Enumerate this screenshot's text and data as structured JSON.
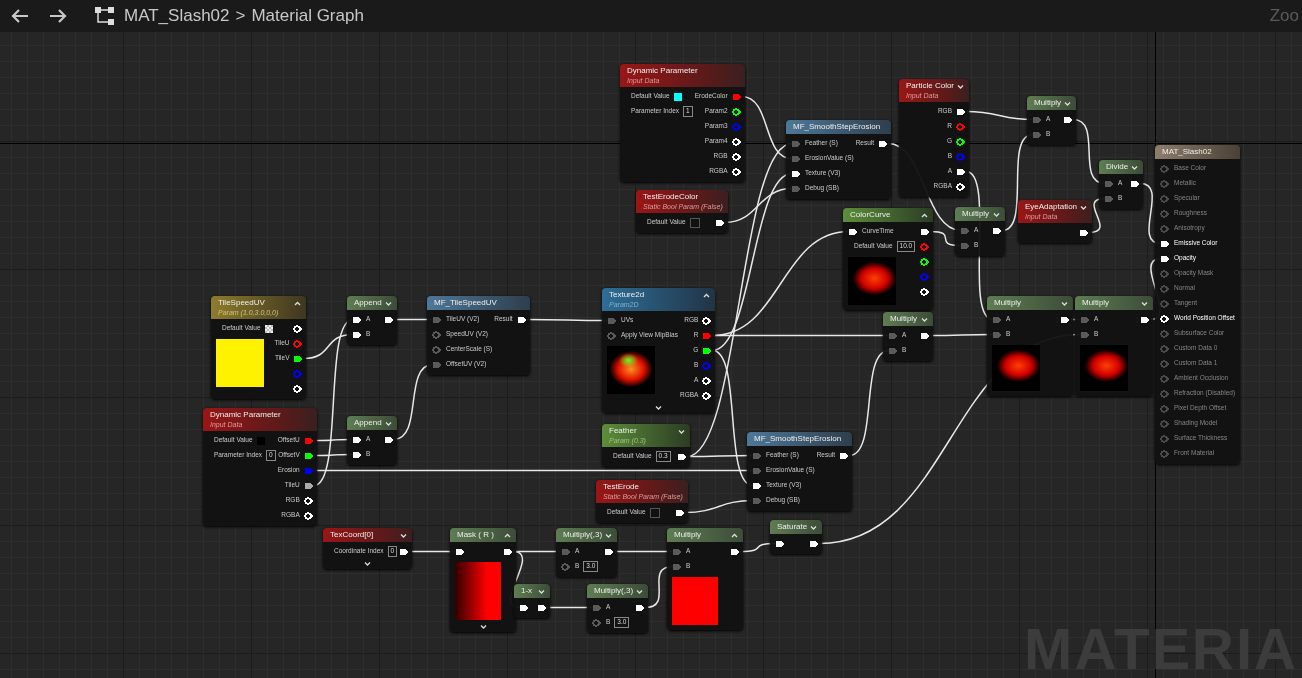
{
  "toolbar": {
    "breadcrumb": [
      {
        "label": "MAT_Slash02"
      },
      {
        "label": "Material Graph"
      }
    ],
    "separator": ">",
    "zoom_label": "Zoo"
  },
  "graph": {
    "watermark": "MATERIA",
    "nodes": [
      {
        "title": "Dynamic Parameter",
        "subtitle": "Input Data",
        "kind": "param",
        "props": [
          {
            "label": "Default Value",
            "kind": "swatch",
            "color": "#00ffff"
          },
          {
            "label": "Parameter Index",
            "kind": "number",
            "value": "1"
          }
        ],
        "outputs": [
          {
            "label": "ErodeColor",
            "color": "#ff0000",
            "connected": true
          },
          {
            "label": "Param2",
            "color": "#00ff00",
            "connected": false
          },
          {
            "label": "Param3",
            "color": "#0000ff",
            "connected": false
          },
          {
            "label": "Param4",
            "color": "#ffffff",
            "connected": false
          },
          {
            "label": "RGB",
            "color": "#ffffff",
            "connected": false
          },
          {
            "label": "RGBA",
            "color": "#ffffff",
            "connected": false
          }
        ]
      },
      {
        "title": "MF_SmoothStepErosion",
        "kind": "function",
        "inputs": [
          {
            "label": "Feather (S)",
            "color": "#5a5a5a",
            "connected": true
          },
          {
            "label": "ErosionValue (S)",
            "color": "#5a5a5a",
            "connected": true
          },
          {
            "label": "Texture (V3)",
            "color": "#ffffff",
            "connected": true
          },
          {
            "label": "Debug (SB)",
            "color": "#5a5a5a",
            "connected": true
          }
        ],
        "outputs": [
          {
            "label": "Result",
            "color": "#ffffff",
            "connected": true
          }
        ]
      },
      {
        "title": "TestErodeColor",
        "subtitle": "Static Bool Param (False)",
        "kind": "param",
        "props": [
          {
            "label": "Default Value",
            "kind": "checkbox",
            "checked": false
          }
        ],
        "outputs": [
          {
            "color": "#ffffff",
            "connected": true
          }
        ]
      },
      {
        "title": "Particle Color",
        "subtitle": "Input Data",
        "kind": "param",
        "expanded": false,
        "outputs": [
          {
            "label": "RGB",
            "color": "#ffffff",
            "connected": true
          },
          {
            "label": "R",
            "color": "#ff0000",
            "connected": false
          },
          {
            "label": "G",
            "color": "#00ff00",
            "connected": false
          },
          {
            "label": "B",
            "color": "#0000ff",
            "connected": false
          },
          {
            "label": "A",
            "color": "#ffffff",
            "connected": true
          },
          {
            "label": "RGBA",
            "color": "#ffffff",
            "connected": false
          }
        ]
      },
      {
        "title": "Multiply",
        "kind": "math",
        "expanded": false,
        "inputs": [
          {
            "label": "A",
            "color": "#5a5a5a",
            "connected": true
          },
          {
            "label": "B",
            "color": "#5a5a5a",
            "connected": true
          }
        ],
        "outputs": [
          {
            "color": "#ffffff",
            "connected": true
          }
        ]
      },
      {
        "title": "Divide",
        "kind": "math",
        "expanded": false,
        "inputs": [
          {
            "label": "A",
            "color": "#5a5a5a",
            "connected": true
          },
          {
            "label": "B",
            "color": "#5a5a5a",
            "connected": true
          }
        ],
        "outputs": [
          {
            "color": "#ffffff",
            "connected": true
          }
        ]
      },
      {
        "title": "EyeAdaptation",
        "subtitle": "Input Data",
        "kind": "param",
        "expanded": false,
        "outputs": [
          {
            "color": "#ffffff",
            "connected": true
          }
        ]
      },
      {
        "title": "ColorCurve",
        "kind": "scalar",
        "expanded": true,
        "inputs": [
          {
            "label": "CurveTime",
            "color": "#ffffff",
            "connected": true
          }
        ],
        "props": [
          {
            "label": "Default Value",
            "kind": "number",
            "value": "10.0"
          }
        ],
        "preview": {
          "kind": "flame"
        },
        "outputs": [
          {
            "color": "#ffffff",
            "connected": true
          },
          {
            "color": "#ff0000",
            "connected": false
          },
          {
            "color": "#00ff00",
            "connected": false
          },
          {
            "color": "#0000ff",
            "connected": false
          },
          {
            "color": "#ffffff",
            "connected": false
          }
        ]
      },
      {
        "title": "Multiply",
        "kind": "math",
        "expanded": false,
        "inputs": [
          {
            "label": "A",
            "color": "#5a5a5a",
            "connected": true
          },
          {
            "label": "B",
            "color": "#5a5a5a",
            "connected": true
          }
        ],
        "outputs": [
          {
            "color": "#ffffff",
            "connected": true
          }
        ]
      },
      {
        "title": "MAT_Slash02",
        "kind": "result",
        "inputs": [
          {
            "label": "Base Color",
            "enabled": false,
            "connected": false
          },
          {
            "label": "Metallic",
            "enabled": false,
            "connected": false
          },
          {
            "label": "Specular",
            "enabled": false,
            "connected": false
          },
          {
            "label": "Roughness",
            "enabled": false,
            "connected": false
          },
          {
            "label": "Anisotropy",
            "enabled": false,
            "connected": false
          },
          {
            "label": "Emissive Color",
            "enabled": true,
            "connected": true
          },
          {
            "label": "Opacity",
            "enabled": true,
            "connected": true
          },
          {
            "label": "Opacity Mask",
            "enabled": false,
            "connected": false
          },
          {
            "label": "Normal",
            "enabled": false,
            "connected": false
          },
          {
            "label": "Tangent",
            "enabled": false,
            "connected": false
          },
          {
            "label": "World Position Offset",
            "enabled": true,
            "connected": false
          },
          {
            "label": "Subsurface Color",
            "enabled": false,
            "connected": false
          },
          {
            "label": "Custom Data 0",
            "enabled": false,
            "connected": false
          },
          {
            "label": "Custom Data 1",
            "enabled": false,
            "connected": false
          },
          {
            "label": "Ambient Occlusion",
            "enabled": false,
            "connected": false
          },
          {
            "label": "Refraction (Disabled)",
            "enabled": false,
            "connected": false
          },
          {
            "label": "Pixel Depth Offset",
            "enabled": false,
            "connected": false
          },
          {
            "label": "Shading Model",
            "enabled": false,
            "connected": false
          },
          {
            "label": "Surface Thickness",
            "enabled": false,
            "connected": false
          },
          {
            "label": "Front Material",
            "enabled": false,
            "connected": false
          }
        ]
      },
      {
        "title": "TileSpeedUV",
        "subtitle": "Param (1.0,3.0,0,0)",
        "kind": "vector",
        "expanded": true,
        "props": [
          {
            "label": "Default Value",
            "kind": "checker"
          }
        ],
        "preview": {
          "kind": "solid",
          "color": "#fff200"
        },
        "outputs": [
          {
            "color": "#ffffff",
            "connected": false
          },
          {
            "label": "TileU",
            "color": "#ff0000",
            "connected": false
          },
          {
            "label": "TileV",
            "color": "#00ff00",
            "connected": true
          },
          {
            "color": "#0000ff",
            "connected": false
          },
          {
            "color": "#ffffff",
            "connected": false
          }
        ]
      },
      {
        "title": "Append",
        "kind": "math",
        "expanded": false,
        "inputs": [
          {
            "label": "A",
            "color": "#ffffff",
            "connected": true
          },
          {
            "label": "B",
            "color": "#ffffff",
            "connected": true
          }
        ],
        "outputs": [
          {
            "color": "#ffffff",
            "connected": true
          }
        ]
      },
      {
        "title": "MF_TileSpeedUV",
        "kind": "function",
        "inputs": [
          {
            "label": "TileUV (V2)",
            "color": "#5a5a5a",
            "connected": true
          },
          {
            "label": "SpeedUV (V2)",
            "color": "#5a5a5a",
            "connected": false
          },
          {
            "label": "CenterScale (S)",
            "color": "#5a5a5a",
            "connected": false
          },
          {
            "label": "OffsetUV (V2)",
            "color": "#5a5a5a",
            "connected": true
          }
        ],
        "outputs": [
          {
            "label": "Result",
            "color": "#ffffff",
            "connected": true
          }
        ]
      },
      {
        "title": "Texture2d",
        "subtitle": "Param2D",
        "kind": "texture",
        "expanded": true,
        "show_more": true,
        "inputs": [
          {
            "label": "UVs",
            "color": "#5a5a5a",
            "connected": true
          },
          {
            "label": "Apply View MipBias",
            "color": "#5a5a5a",
            "connected": false
          }
        ],
        "preview": {
          "kind": "flame_green"
        },
        "outputs": [
          {
            "label": "RGB",
            "color": "#ffffff",
            "connected": false
          },
          {
            "label": "R",
            "color": "#ff0000",
            "connected": true
          },
          {
            "label": "G",
            "color": "#00ff00",
            "connected": true
          },
          {
            "label": "B",
            "color": "#0000ff",
            "connected": false
          },
          {
            "label": "A",
            "color": "#ffffff",
            "connected": false
          },
          {
            "label": "RGBA",
            "color": "#ffffff",
            "connected": false
          }
        ]
      },
      {
        "title": "Dynamic Parameter",
        "subtitle": "Input Data",
        "kind": "param",
        "props": [
          {
            "label": "Default Value",
            "kind": "swatch",
            "color": "#000000"
          },
          {
            "label": "Parameter Index",
            "kind": "number",
            "value": "0"
          }
        ],
        "outputs": [
          {
            "label": "OffsetU",
            "color": "#ff0000",
            "connected": true
          },
          {
            "label": "OffsetV",
            "color": "#00ff00",
            "connected": true
          },
          {
            "label": "Erosion",
            "color": "#0000ff",
            "connected": true
          },
          {
            "label": "TileU",
            "color": "#aaaaaa",
            "connected": true
          },
          {
            "label": "RGB",
            "color": "#ffffff",
            "connected": false
          },
          {
            "label": "RGBA",
            "color": "#ffffff",
            "connected": false
          }
        ]
      },
      {
        "title": "Append",
        "kind": "math",
        "expanded": false,
        "inputs": [
          {
            "label": "A",
            "color": "#ffffff",
            "connected": true
          },
          {
            "label": "B",
            "color": "#ffffff",
            "connected": true
          }
        ],
        "outputs": [
          {
            "color": "#ffffff",
            "connected": true
          }
        ]
      },
      {
        "title": "Multiply",
        "kind": "math",
        "expanded": false,
        "inputs": [
          {
            "label": "A",
            "color": "#5a5a5a",
            "connected": true
          },
          {
            "label": "B",
            "color": "#5a5a5a",
            "connected": true
          }
        ],
        "outputs": [
          {
            "color": "#ffffff",
            "connected": true
          }
        ]
      },
      {
        "title": "Multiply",
        "kind": "math",
        "expanded": false,
        "inputs": [
          {
            "label": "A",
            "color": "#5a5a5a",
            "connected": true
          },
          {
            "label": "B",
            "color": "#5a5a5a",
            "connected": true
          }
        ],
        "preview": {
          "kind": "flame"
        },
        "outputs": [
          {
            "color": "#ffffff",
            "connected": true
          }
        ]
      },
      {
        "title": "Multiply",
        "kind": "math",
        "expanded": false,
        "inputs": [
          {
            "label": "A",
            "color": "#5a5a5a",
            "connected": true
          },
          {
            "label": "B",
            "color": "#5a5a5a",
            "connected": true
          }
        ],
        "preview": {
          "kind": "flame"
        },
        "outputs": [
          {
            "color": "#ffffff",
            "connected": true
          }
        ]
      },
      {
        "title": "Feather",
        "subtitle": "Param (0.3)",
        "kind": "scalar",
        "expanded": false,
        "props": [
          {
            "label": "Default Value",
            "kind": "number",
            "value": "0.3"
          }
        ],
        "outputs": [
          {
            "color": "#ffffff",
            "connected": true
          }
        ]
      },
      {
        "title": "MF_SmoothStepErosion",
        "kind": "function",
        "inputs": [
          {
            "label": "Feather (S)",
            "color": "#5a5a5a",
            "connected": true
          },
          {
            "label": "ErosionValue (S)",
            "color": "#5a5a5a",
            "connected": true
          },
          {
            "label": "Texture (V3)",
            "color": "#ffffff",
            "connected": true
          },
          {
            "label": "Debug (SB)",
            "color": "#5a5a5a",
            "connected": true
          }
        ],
        "outputs": [
          {
            "label": "Result",
            "color": "#ffffff",
            "connected": true
          }
        ]
      },
      {
        "title": "TestErode",
        "subtitle": "Static Bool Param (False)",
        "kind": "param",
        "props": [
          {
            "label": "Default Value",
            "kind": "checkbox",
            "checked": false
          }
        ],
        "outputs": [
          {
            "color": "#ffffff",
            "connected": true
          }
        ]
      },
      {
        "title": "TexCoord[0]",
        "kind": "param",
        "expanded": false,
        "show_more": true,
        "props": [
          {
            "label": "Coordinate Index",
            "kind": "number",
            "value": "0"
          }
        ],
        "outputs": [
          {
            "color": "#ffffff",
            "connected": true
          }
        ]
      },
      {
        "title": "Mask ( R )",
        "kind": "math",
        "expanded": true,
        "show_more": true,
        "inputs": [
          {
            "color": "#ffffff",
            "connected": true
          }
        ],
        "preview": {
          "kind": "gradient",
          "color": "#ff0000"
        },
        "outputs": [
          {
            "color": "#ffffff",
            "connected": true
          }
        ]
      },
      {
        "title": "Multiply(,3)",
        "kind": "math",
        "expanded": false,
        "inputs": [
          {
            "label": "A",
            "color": "#5a5a5a",
            "connected": true
          },
          {
            "label": "B",
            "color": "#5a5a5a",
            "connected": false,
            "value": "3.0"
          }
        ],
        "outputs": [
          {
            "color": "#ffffff",
            "connected": true
          }
        ]
      },
      {
        "title": "1-x",
        "kind": "math",
        "expanded": false,
        "inputs": [
          {
            "color": "#ffffff",
            "connected": true
          }
        ],
        "outputs": [
          {
            "color": "#ffffff",
            "connected": true
          }
        ]
      },
      {
        "title": "Multiply(,3)",
        "kind": "math",
        "expanded": false,
        "inputs": [
          {
            "label": "A",
            "color": "#5a5a5a",
            "connected": true
          },
          {
            "label": "B",
            "color": "#5a5a5a",
            "connected": false,
            "value": "3.0"
          }
        ],
        "outputs": [
          {
            "color": "#ffffff",
            "connected": true
          }
        ]
      },
      {
        "title": "Multiply",
        "kind": "math",
        "expanded": true,
        "inputs": [
          {
            "label": "A",
            "color": "#5a5a5a",
            "connected": true
          },
          {
            "label": "B",
            "color": "#5a5a5a",
            "connected": true
          }
        ],
        "preview": {
          "kind": "solid",
          "color": "#ff0000"
        },
        "outputs": [
          {
            "color": "#ffffff",
            "connected": true
          }
        ]
      },
      {
        "title": "Saturate",
        "kind": "math",
        "expanded": false,
        "inputs": [
          {
            "color": "#ffffff",
            "connected": true
          }
        ],
        "outputs": [
          {
            "color": "#ffffff",
            "connected": true
          }
        ]
      }
    ]
  }
}
